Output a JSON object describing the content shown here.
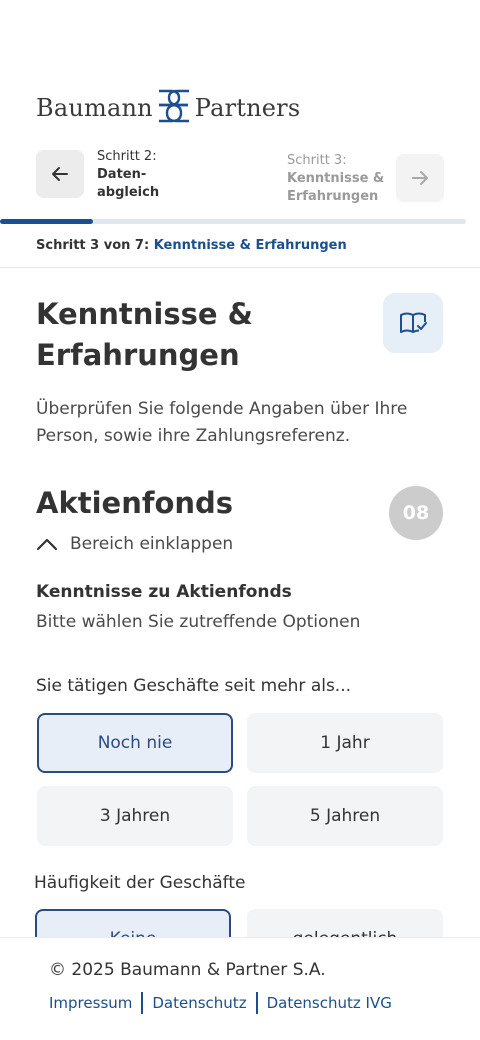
{
  "brand": {
    "name_left": "Baumann",
    "name_right": "Partners",
    "mark_icon": "bp-monogram-icon"
  },
  "stepnav": {
    "prev": {
      "label": "Schritt 2:",
      "name_line1": "Daten-",
      "name_line2": "abgleich",
      "icon": "arrow-left-icon"
    },
    "next": {
      "label": "Schritt 3:",
      "name_line1": "Kenntnisse &",
      "name_line2": "Erfahrungen",
      "icon": "arrow-right-icon"
    },
    "progress_fraction": 0.2
  },
  "stepline": {
    "prefix": "Schritt 3 von 7:",
    "current": "Kenntnisse & Erfahrungen"
  },
  "page": {
    "title": "Kenntnisse & Erfahrungen",
    "icon": "book-check-icon",
    "intro": "Überprüfen Sie folgende Angaben über Ihre Person, sowie ihre Zahlungsreferenz."
  },
  "section": {
    "title": "Aktienfonds",
    "badge": "08",
    "collapse_label": "Bereich einklappen",
    "subheading": "Kenntnisse zu Aktienfonds",
    "subtext": "Bitte wählen Sie zutreffende Optionen",
    "question1": {
      "label": "Sie tätigen Geschäfte seit mehr als...",
      "options": [
        "Noch nie",
        "1 Jahr",
        "3 Jahren",
        "5 Jahren"
      ],
      "selected": "Noch nie"
    },
    "question2": {
      "label": "Häufigkeit der Geschäfte",
      "options": [
        "Keine",
        "gelegentlich"
      ],
      "selected": "Keine"
    }
  },
  "footer": {
    "copyright": "© 2025 Baumann & Partner S.A.",
    "links": [
      "Impressum",
      "Datenschutz",
      "Datenschutz IVG"
    ]
  },
  "colors": {
    "accent": "#1b4f8c",
    "selected_border": "#2b4c7e",
    "selected_bg": "#e7eef8",
    "option_bg": "#f3f4f5",
    "badge": "#cccccc"
  }
}
